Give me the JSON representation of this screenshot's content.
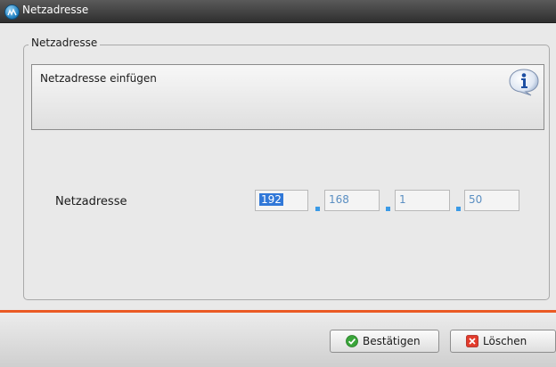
{
  "window": {
    "title": "Netzadresse"
  },
  "group": {
    "legend": "Netzadresse"
  },
  "info": {
    "text": "Netzadresse einfügen",
    "icon": "info-icon"
  },
  "address": {
    "label": "Netzadresse",
    "octets": [
      "192",
      "168",
      "1",
      "50"
    ],
    "selected_octet_index": 0
  },
  "buttons": {
    "confirm": "Bestätigen",
    "delete": "Löschen"
  },
  "colors": {
    "title_bar": "#3d3d3d",
    "accent_separator": "#ea5a24",
    "selection": "#3178d8",
    "octet_text": "#5b8fc2"
  }
}
